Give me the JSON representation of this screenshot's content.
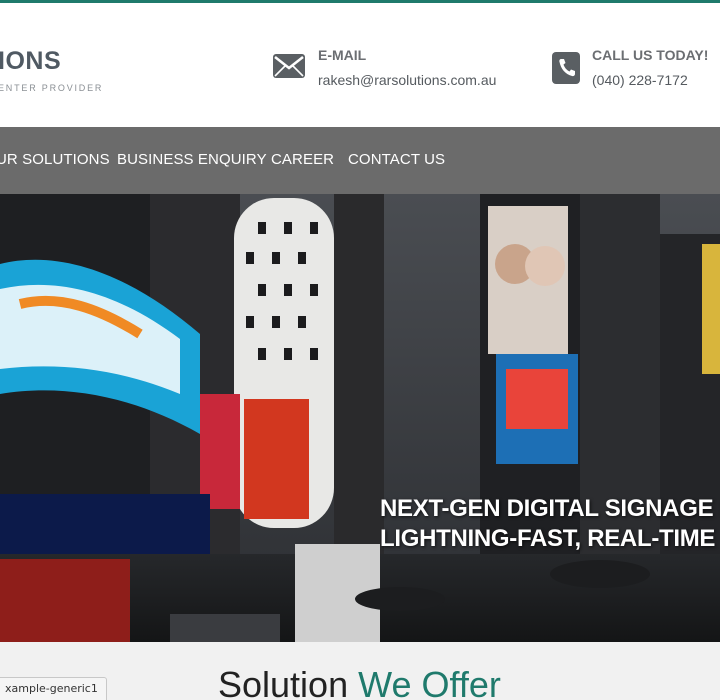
{
  "brand": {
    "title": "IONS",
    "tagline": "ENTER PROVIDER"
  },
  "contact": {
    "email": {
      "label": "E-MAIL",
      "value": "rakesh@rarsolutions.com.au",
      "icon": "envelope-icon"
    },
    "phone": {
      "label": "CALL US TODAY!",
      "value": "(040) 228-7172",
      "icon": "phone-icon"
    }
  },
  "nav": {
    "items": [
      {
        "label": "UR SOLUTIONS"
      },
      {
        "label": "BUSINESS ENQUIRY"
      },
      {
        "label": "CAREER"
      },
      {
        "label": "CONTACT US"
      }
    ]
  },
  "hero": {
    "heading_line1": "NEXT-GEN DIGITAL SIGNAGE S",
    "heading_line2": "LIGHTNING-FAST, REAL-TIME"
  },
  "section": {
    "title_part1": "Solution",
    "title_part2": "We Offer"
  },
  "tooltip": {
    "text": "xample-generic1"
  },
  "colors": {
    "accent": "#1f7a6c",
    "nav_bg": "#6b6b6b",
    "icon_gray": "#5a5f63"
  }
}
